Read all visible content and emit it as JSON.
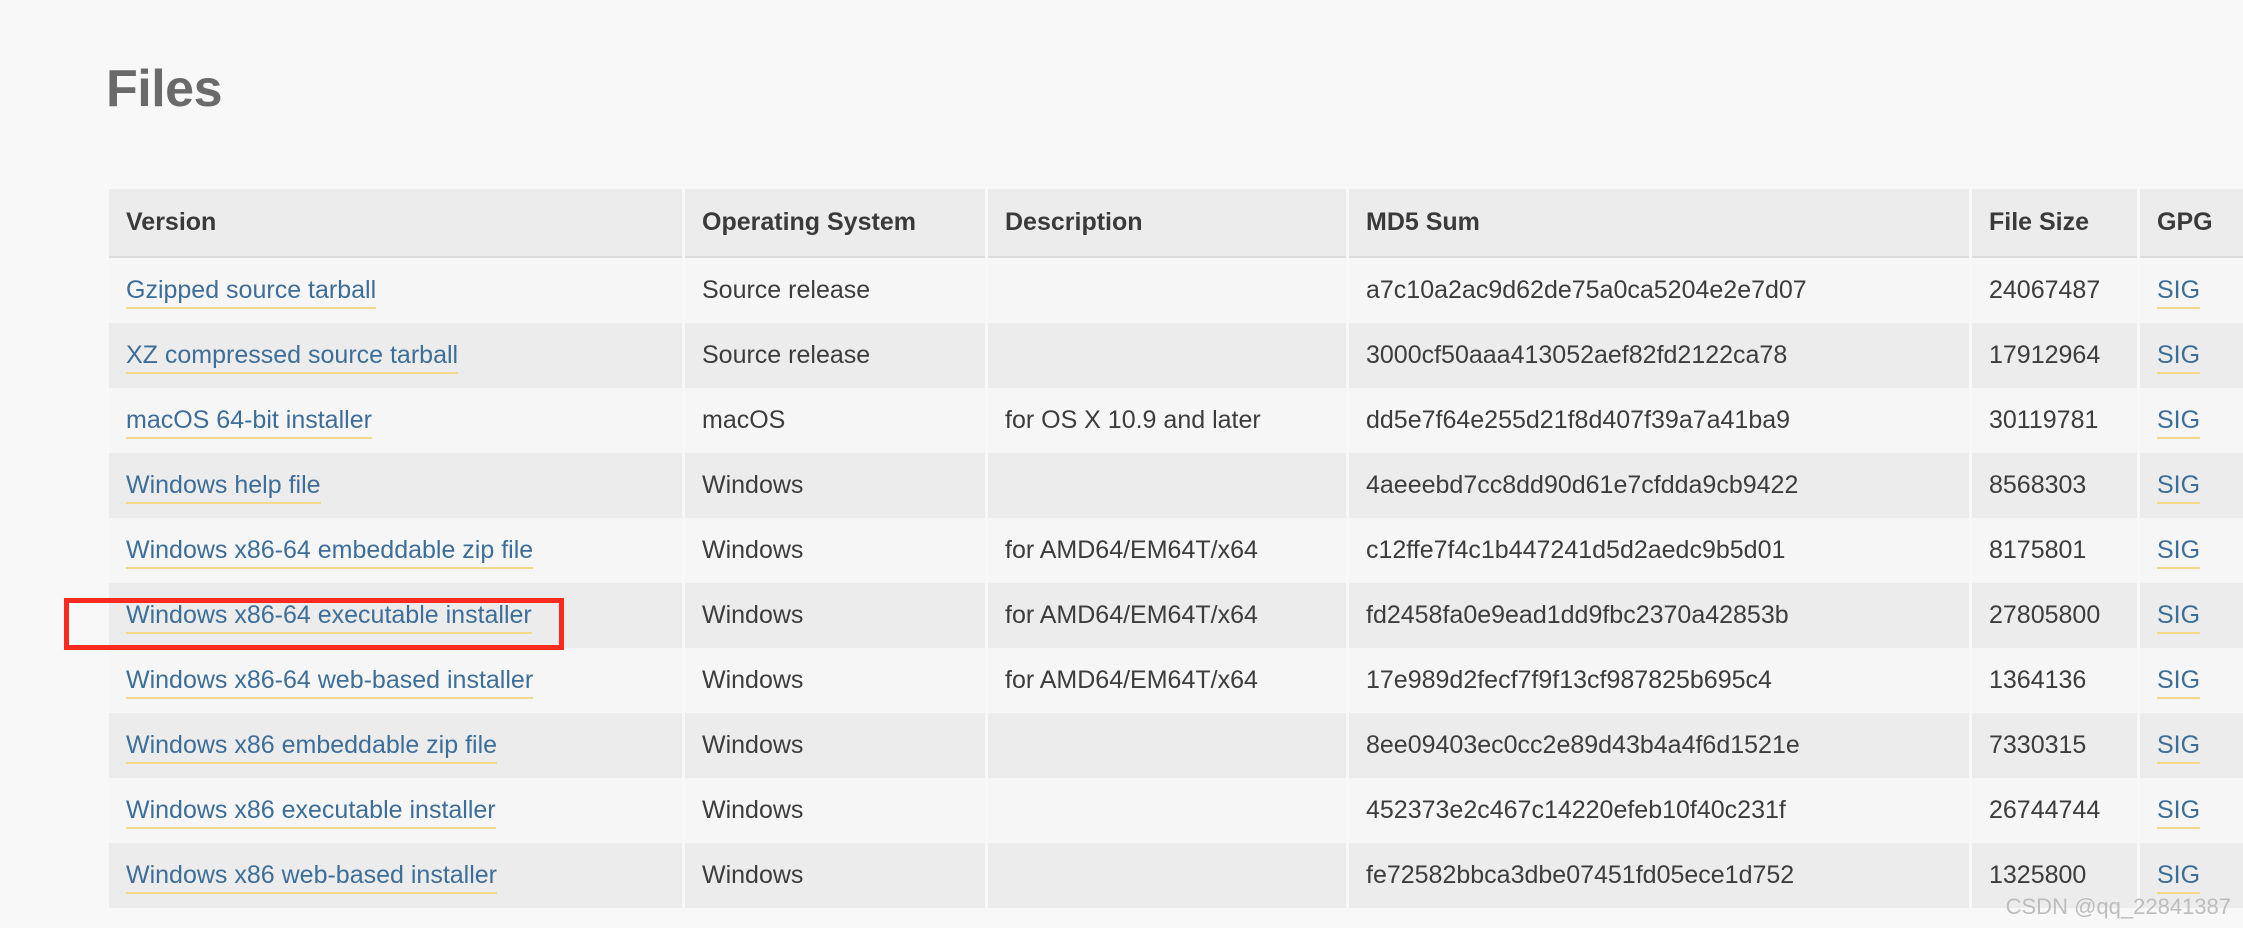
{
  "page": {
    "title": "Files",
    "watermark": "CSDN @qq_22841387",
    "accent_link_color": "#3d6e99",
    "link_underline_color": "#f2d88a",
    "annotation_color": "#fa2a21",
    "header_bg": "#ececec",
    "row_odd_bg": "#f6f6f6",
    "row_even_bg": "#ececec",
    "page_bg": "#f8f8f8"
  },
  "table": {
    "columns": [
      {
        "key": "version",
        "label": "Version"
      },
      {
        "key": "os",
        "label": "Operating System"
      },
      {
        "key": "description",
        "label": "Description"
      },
      {
        "key": "md5",
        "label": "MD5 Sum"
      },
      {
        "key": "size",
        "label": "File Size"
      },
      {
        "key": "gpg",
        "label": "GPG"
      }
    ],
    "rows": [
      {
        "version": "Gzipped source tarball",
        "os": "Source release",
        "description": "",
        "md5": "a7c10a2ac9d62de75a0ca5204e2e7d07",
        "size": "24067487",
        "gpg": "SIG",
        "highlighted": false
      },
      {
        "version": "XZ compressed source tarball",
        "os": "Source release",
        "description": "",
        "md5": "3000cf50aaa413052aef82fd2122ca78",
        "size": "17912964",
        "gpg": "SIG",
        "highlighted": false
      },
      {
        "version": "macOS 64-bit installer",
        "os": "macOS",
        "description": "for OS X 10.9 and later",
        "md5": "dd5e7f64e255d21f8d407f39a7a41ba9",
        "size": "30119781",
        "gpg": "SIG",
        "highlighted": false
      },
      {
        "version": "Windows help file",
        "os": "Windows",
        "description": "",
        "md5": "4aeeebd7cc8dd90d61e7cfdda9cb9422",
        "size": "8568303",
        "gpg": "SIG",
        "highlighted": false
      },
      {
        "version": "Windows x86-64 embeddable zip file",
        "os": "Windows",
        "description": "for AMD64/EM64T/x64",
        "md5": "c12ffe7f4c1b447241d5d2aedc9b5d01",
        "size": "8175801",
        "gpg": "SIG",
        "highlighted": false
      },
      {
        "version": "Windows x86-64 executable installer",
        "os": "Windows",
        "description": "for AMD64/EM64T/x64",
        "md5": "fd2458fa0e9ead1dd9fbc2370a42853b",
        "size": "27805800",
        "gpg": "SIG",
        "highlighted": true
      },
      {
        "version": "Windows x86-64 web-based installer",
        "os": "Windows",
        "description": "for AMD64/EM64T/x64",
        "md5": "17e989d2fecf7f9f13cf987825b695c4",
        "size": "1364136",
        "gpg": "SIG",
        "highlighted": false
      },
      {
        "version": "Windows x86 embeddable zip file",
        "os": "Windows",
        "description": "",
        "md5": "8ee09403ec0cc2e89d43b4a4f6d1521e",
        "size": "7330315",
        "gpg": "SIG",
        "highlighted": false
      },
      {
        "version": "Windows x86 executable installer",
        "os": "Windows",
        "description": "",
        "md5": "452373e2c467c14220efeb10f40c231f",
        "size": "26744744",
        "gpg": "SIG",
        "highlighted": false
      },
      {
        "version": "Windows x86 web-based installer",
        "os": "Windows",
        "description": "",
        "md5": "fe72582bbca3dbe07451fd05ece1d752",
        "size": "1325800",
        "gpg": "SIG",
        "highlighted": false
      }
    ]
  }
}
